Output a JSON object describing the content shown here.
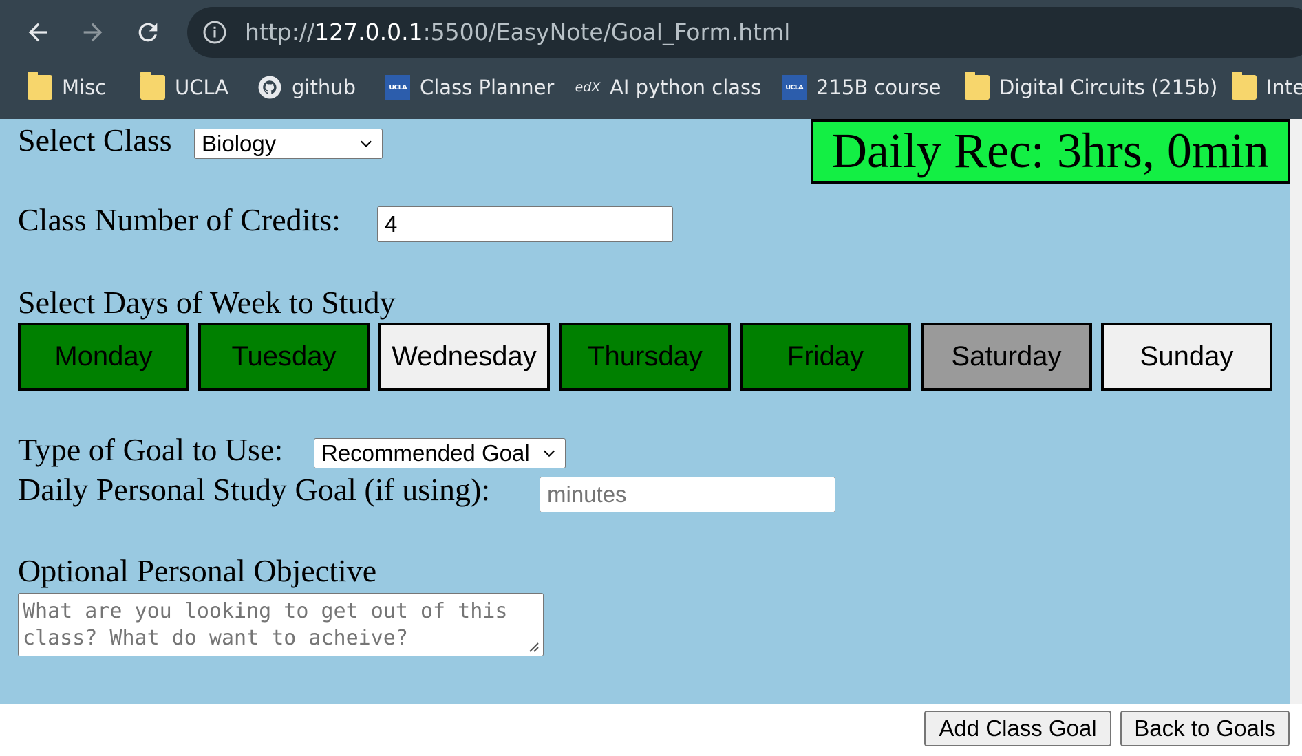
{
  "browser": {
    "url_prefix": "http://",
    "url_host": "127.0.0.1",
    "url_path": ":5500/EasyNote/Goal_Form.html",
    "bookmarks": [
      {
        "label": "Misc",
        "icon": "folder-icon"
      },
      {
        "label": "UCLA",
        "icon": "folder-icon"
      },
      {
        "label": "github",
        "icon": "github-icon"
      },
      {
        "label": "Class Planner",
        "icon": "ucla-icon"
      },
      {
        "label": "AI python class",
        "icon": "edx-icon"
      },
      {
        "label": "215B course",
        "icon": "ucla-icon"
      },
      {
        "label": "Digital Circuits (215b)",
        "icon": "folder-icon"
      },
      {
        "label": "Inte",
        "icon": "folder-icon"
      }
    ],
    "ucla_badge": "UCLA",
    "edx_badge": "edX"
  },
  "form": {
    "select_class_label": "Select Class",
    "select_class_value": "Biology",
    "daily_rec": "Daily Rec: 3hrs, 0min",
    "credits_label": "Class Number of Credits:",
    "credits_value": "4",
    "days_label": "Select Days of Week to Study",
    "days": [
      {
        "label": "Monday",
        "state": "selected",
        "color": "#008000"
      },
      {
        "label": "Tuesday",
        "state": "selected",
        "color": "#008000"
      },
      {
        "label": "Wednesday",
        "state": "unselected",
        "color": "#f0f0f0"
      },
      {
        "label": "Thursday",
        "state": "selected",
        "color": "#008000"
      },
      {
        "label": "Friday",
        "state": "selected",
        "color": "#008000"
      },
      {
        "label": "Saturday",
        "state": "disabled",
        "color": "#9a9a9a"
      },
      {
        "label": "Sunday",
        "state": "unselected",
        "color": "#f0f0f0"
      }
    ],
    "goal_type_label": "Type of Goal to Use:",
    "goal_type_value": "Recommended Goal",
    "personal_goal_label": "Daily Personal Study Goal (if using):",
    "personal_goal_placeholder": "minutes",
    "objective_label": "Optional Personal Objective",
    "objective_placeholder": "What are you looking to get out of this class? What do want to acheive?"
  },
  "actions": {
    "add_label": "Add Class Goal",
    "back_label": "Back to Goals"
  },
  "colors": {
    "page_bg": "#99c9e1",
    "daily_rec_bg": "#13ef44",
    "day_selected": "#008000"
  }
}
